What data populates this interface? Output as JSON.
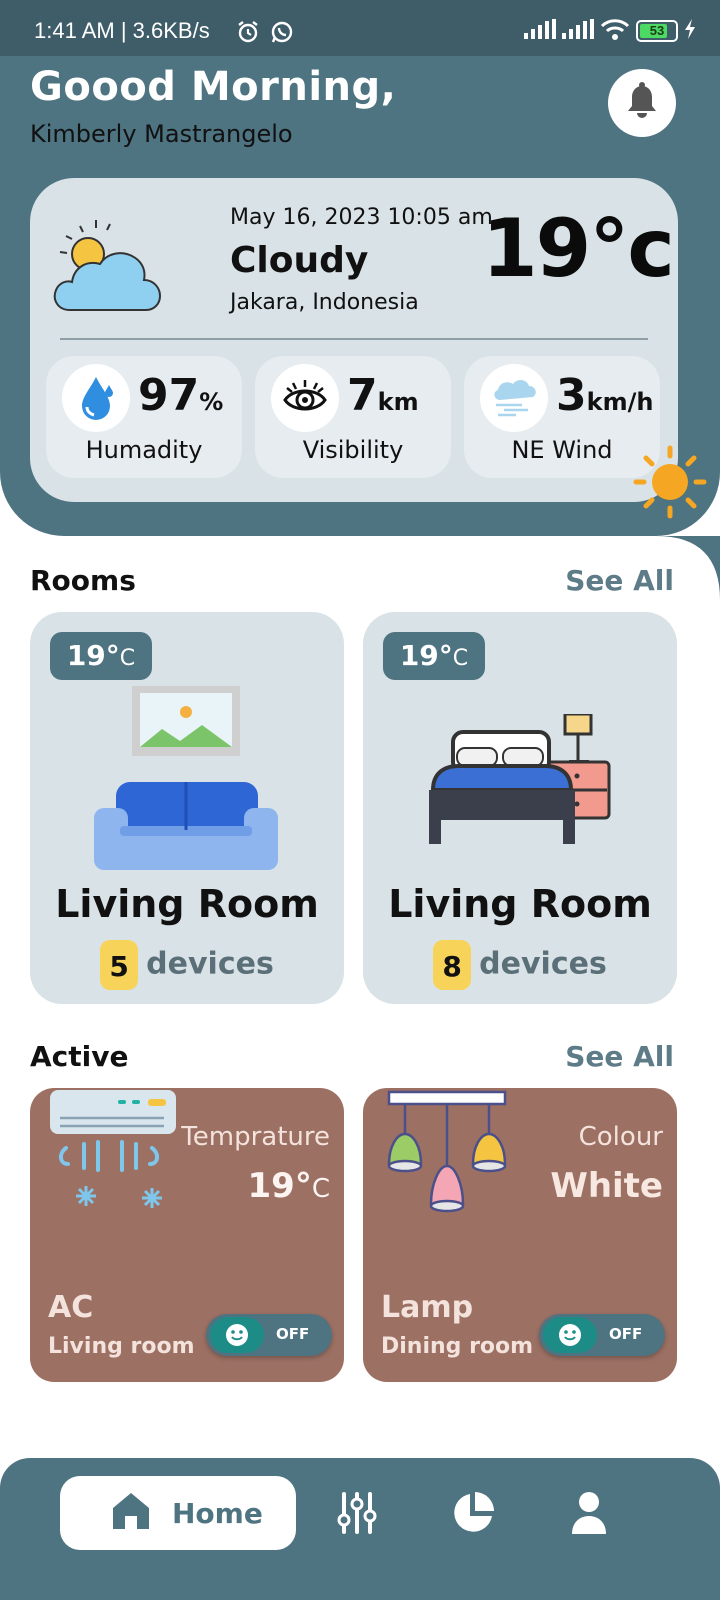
{
  "status_bar": {
    "text": "1:41 AM | 3.6KB/s",
    "battery": "53",
    "icons": [
      "alarm-icon",
      "whatsapp-icon",
      "signal-icon",
      "signal-icon",
      "wifi-icon",
      "battery-icon",
      "charging-icon"
    ]
  },
  "header": {
    "greeting": "Goood Morning,",
    "user_name": "Kimberly Mastrangelo",
    "bell_icon": "bell-icon"
  },
  "weather": {
    "date": "May 16, 2023 10:05 am",
    "condition": "Cloudy",
    "location": "Jakara, Indonesia",
    "temperature": "19°c",
    "stats": [
      {
        "value": "97",
        "unit": "%",
        "label": "Humadity",
        "icon": "water-drop-icon"
      },
      {
        "value": "7",
        "unit": "km",
        "label": "Visibility",
        "icon": "eye-icon"
      },
      {
        "value": "3",
        "unit": "km/h",
        "label": "NE Wind",
        "icon": "wind-cloud-icon"
      }
    ]
  },
  "rooms": {
    "title": "Rooms",
    "see_all": "See All",
    "items": [
      {
        "temp": "19°",
        "temp_unit": "C",
        "name": "Living Room",
        "device_count": "5",
        "devices_label": "devices",
        "icon": "sofa-icon"
      },
      {
        "temp": "19°",
        "temp_unit": "C",
        "name": "Living Room",
        "device_count": "8",
        "devices_label": "devices",
        "icon": "bed-icon"
      }
    ]
  },
  "active": {
    "title": "Active",
    "see_all": "See All",
    "items": [
      {
        "label": "Temprature",
        "value": "19°",
        "value_unit": "C",
        "name": "AC",
        "room": "Living room",
        "toggle": "OFF",
        "icon": "air-conditioner-icon"
      },
      {
        "label": "Colour",
        "value": "White",
        "name": "Lamp",
        "room": "Dining room",
        "toggle": "OFF",
        "icon": "pendant-lamp-icon"
      }
    ]
  },
  "bottom_nav": {
    "home_label": "Home",
    "items": [
      "home-icon",
      "sliders-icon",
      "pie-chart-icon",
      "user-icon"
    ]
  },
  "colors": {
    "header": "#4e7381",
    "card": "#d9e2e6",
    "active_card": "#9c7063",
    "badge": "#f7d35a"
  }
}
